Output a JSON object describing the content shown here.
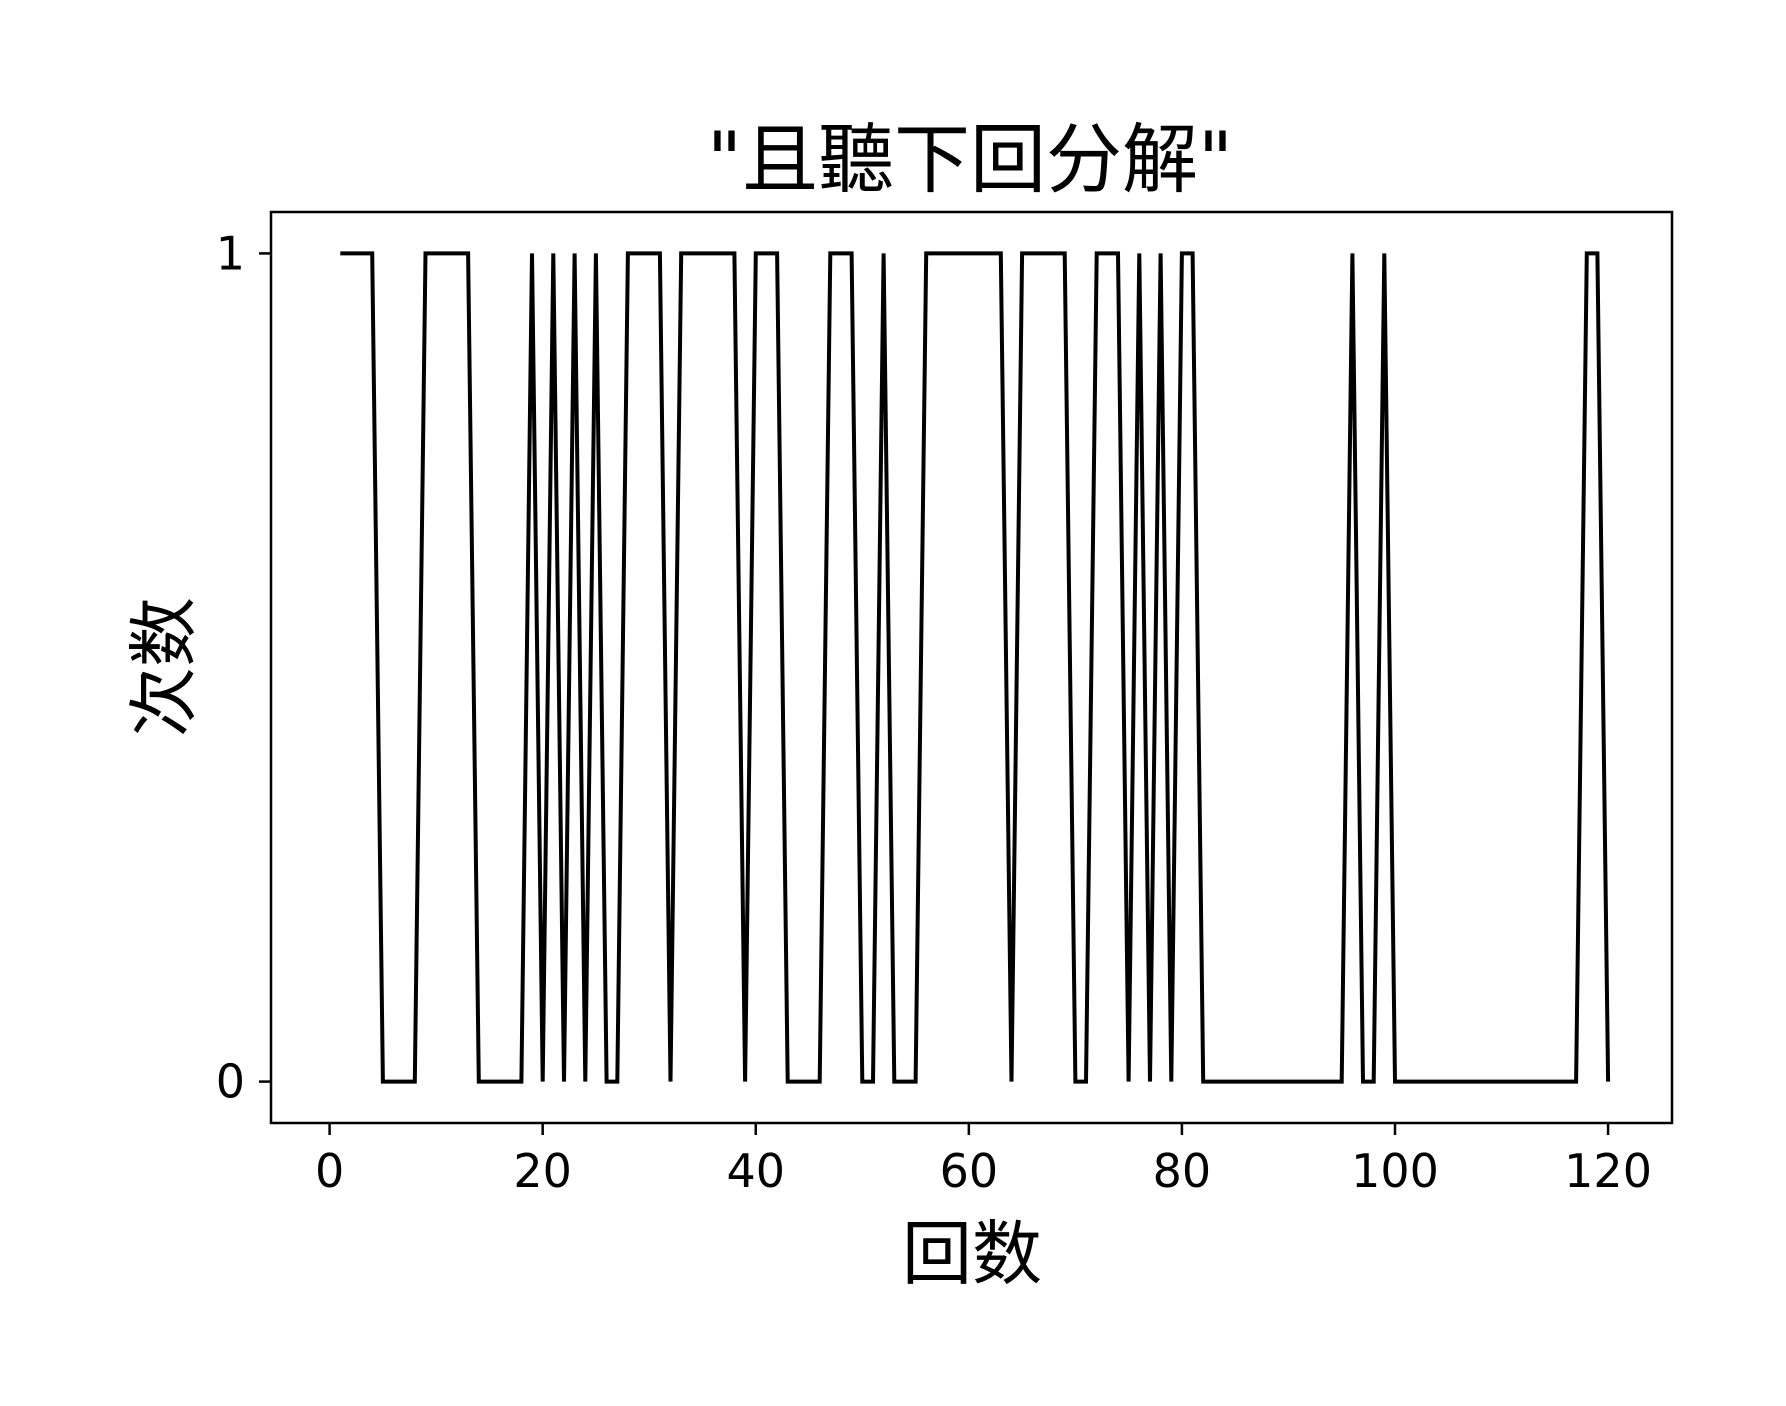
{
  "chart_data": {
    "type": "line",
    "title": "\"且聽下回分解\"",
    "xlabel": "回数",
    "ylabel": "次数",
    "xlim": [
      -5.5,
      126
    ],
    "ylim": [
      -0.05,
      1.05
    ],
    "xticks": [
      0,
      20,
      40,
      60,
      80,
      100,
      120
    ],
    "yticks": [
      0,
      1
    ],
    "grid": false,
    "legend": "none",
    "colors": {
      "line": "#000000",
      "axes": "#000000",
      "background": "#ffffff"
    },
    "series": [
      {
        "x": [
          1,
          2,
          3,
          4,
          5,
          6,
          7,
          8,
          9,
          10,
          11,
          12,
          13,
          14,
          15,
          16,
          17,
          18,
          19,
          20,
          21,
          22,
          23,
          24,
          25,
          26,
          27,
          28,
          29,
          30,
          31,
          32,
          33,
          34,
          35,
          36,
          37,
          38,
          39,
          40,
          41,
          42,
          43,
          44,
          45,
          46,
          47,
          48,
          49,
          50,
          51,
          52,
          53,
          54,
          55,
          56,
          57,
          58,
          59,
          60,
          61,
          62,
          63,
          64,
          65,
          66,
          67,
          68,
          69,
          70,
          71,
          72,
          73,
          74,
          75,
          76,
          77,
          78,
          79,
          80,
          81,
          82,
          83,
          84,
          85,
          86,
          87,
          88,
          89,
          90,
          91,
          92,
          93,
          94,
          95,
          96,
          97,
          98,
          99,
          100,
          101,
          102,
          103,
          104,
          105,
          106,
          107,
          108,
          109,
          110,
          111,
          112,
          113,
          114,
          115,
          116,
          117,
          118,
          119,
          120
        ],
        "values": [
          1,
          1,
          1,
          1,
          0,
          0,
          0,
          0,
          1,
          1,
          1,
          1,
          1,
          0,
          0,
          0,
          0,
          0,
          1,
          0,
          1,
          0,
          1,
          0,
          1,
          0,
          0,
          1,
          1,
          1,
          1,
          0,
          1,
          1,
          1,
          1,
          1,
          1,
          0,
          1,
          1,
          1,
          0,
          0,
          0,
          0,
          1,
          1,
          1,
          0,
          0,
          1,
          0,
          0,
          0,
          1,
          1,
          1,
          1,
          1,
          1,
          1,
          1,
          0,
          1,
          1,
          1,
          1,
          1,
          0,
          0,
          1,
          1,
          1,
          0,
          1,
          0,
          1,
          0,
          1,
          1,
          0,
          0,
          0,
          0,
          0,
          0,
          0,
          0,
          0,
          0,
          0,
          0,
          0,
          0,
          1,
          0,
          0,
          1,
          0,
          0,
          0,
          0,
          0,
          0,
          0,
          0,
          0,
          0,
          0,
          0,
          0,
          0,
          0,
          0,
          0,
          0,
          1,
          1,
          0
        ]
      }
    ]
  }
}
